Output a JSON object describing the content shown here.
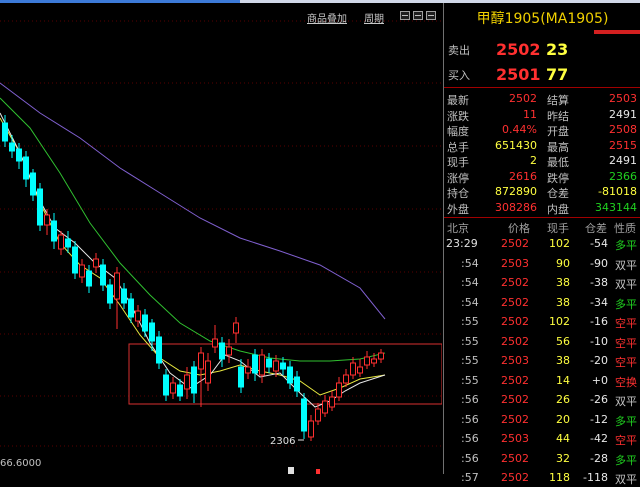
{
  "toolbar": {
    "add_product": "商品叠加",
    "period": "周期"
  },
  "chart": {
    "low_label": "2306",
    "price_readout": "66.6000",
    "colors": {
      "up": "#ff3030",
      "down": "#00ffff",
      "ma_white": "#e8e8e8",
      "ma_yellow": "#e8e840",
      "ma_green": "#30c030",
      "ma_purple": "#8060d0",
      "box": "#d83030"
    }
  },
  "panel": {
    "title": "甲醇1905(MA1905)",
    "sell": {
      "label": "卖出",
      "price": "2502",
      "volume": "23"
    },
    "buy": {
      "label": "买入",
      "price": "2501",
      "volume": "77"
    },
    "stats": [
      {
        "l1": "最新",
        "v1": "2502",
        "c1": "red",
        "l2": "结算",
        "v2": "2503",
        "c2": "red"
      },
      {
        "l1": "涨跌",
        "v1": "11",
        "c1": "red",
        "l2": "昨结",
        "v2": "2491",
        "c2": "wht2"
      },
      {
        "l1": "幅度",
        "v1": "0.44%",
        "c1": "red",
        "l2": "开盘",
        "v2": "2508",
        "c2": "red"
      },
      {
        "l1": "总手",
        "v1": "651430",
        "c1": "yel",
        "l2": "最高",
        "v2": "2515",
        "c2": "red"
      },
      {
        "l1": "现手",
        "v1": "2",
        "c1": "yel",
        "l2": "最低",
        "v2": "2491",
        "c2": "wht2"
      },
      {
        "l1": "涨停",
        "v1": "2616",
        "c1": "red",
        "l2": "跌停",
        "v2": "2366",
        "c2": "grn"
      },
      {
        "l1": "持仓",
        "v1": "872890",
        "c1": "yel",
        "l2": "仓差",
        "v2": "-81018",
        "c2": "yel"
      },
      {
        "l1": "外盘",
        "v1": "308286",
        "c1": "red",
        "l2": "内盘",
        "v2": "343144",
        "c2": "grn"
      }
    ],
    "ticks_header": {
      "region": "北京",
      "price": "价格",
      "volume": "现手",
      "oi_change": "仓差",
      "nature": "性质"
    },
    "ticks": [
      {
        "time": "23:29",
        "price": "2502",
        "volume": "102",
        "chg": "-54",
        "type": "多平",
        "pc": "red",
        "tc": "grn"
      },
      {
        "time": ":54",
        "price": "2503",
        "volume": "90",
        "chg": "-90",
        "type": "双平",
        "pc": "red",
        "tc": "gray"
      },
      {
        "time": ":54",
        "price": "2502",
        "volume": "38",
        "chg": "-38",
        "type": "双平",
        "pc": "red",
        "tc": "gray"
      },
      {
        "time": ":54",
        "price": "2502",
        "volume": "38",
        "chg": "-34",
        "type": "多平",
        "pc": "red",
        "tc": "grn"
      },
      {
        "time": ":55",
        "price": "2502",
        "volume": "102",
        "chg": "-16",
        "type": "空平",
        "pc": "red",
        "tc": "red"
      },
      {
        "time": ":55",
        "price": "2502",
        "volume": "56",
        "chg": "-10",
        "type": "空平",
        "pc": "red",
        "tc": "red"
      },
      {
        "time": ":55",
        "price": "2503",
        "volume": "38",
        "chg": "-20",
        "type": "空平",
        "pc": "red",
        "tc": "red"
      },
      {
        "time": ":55",
        "price": "2502",
        "volume": "14",
        "chg": "+0",
        "type": "空换",
        "pc": "red",
        "tc": "red"
      },
      {
        "time": ":56",
        "price": "2502",
        "volume": "26",
        "chg": "-26",
        "type": "双平",
        "pc": "red",
        "tc": "gray"
      },
      {
        "time": ":56",
        "price": "2502",
        "volume": "20",
        "chg": "-12",
        "type": "多平",
        "pc": "red",
        "tc": "grn"
      },
      {
        "time": ":56",
        "price": "2503",
        "volume": "44",
        "chg": "-42",
        "type": "空平",
        "pc": "red",
        "tc": "red"
      },
      {
        "time": ":56",
        "price": "2502",
        "volume": "32",
        "chg": "-28",
        "type": "多平",
        "pc": "red",
        "tc": "grn"
      },
      {
        "time": ":57",
        "price": "2502",
        "volume": "118",
        "chg": "-118",
        "type": "双平",
        "pc": "red",
        "tc": "gray"
      }
    ]
  }
}
